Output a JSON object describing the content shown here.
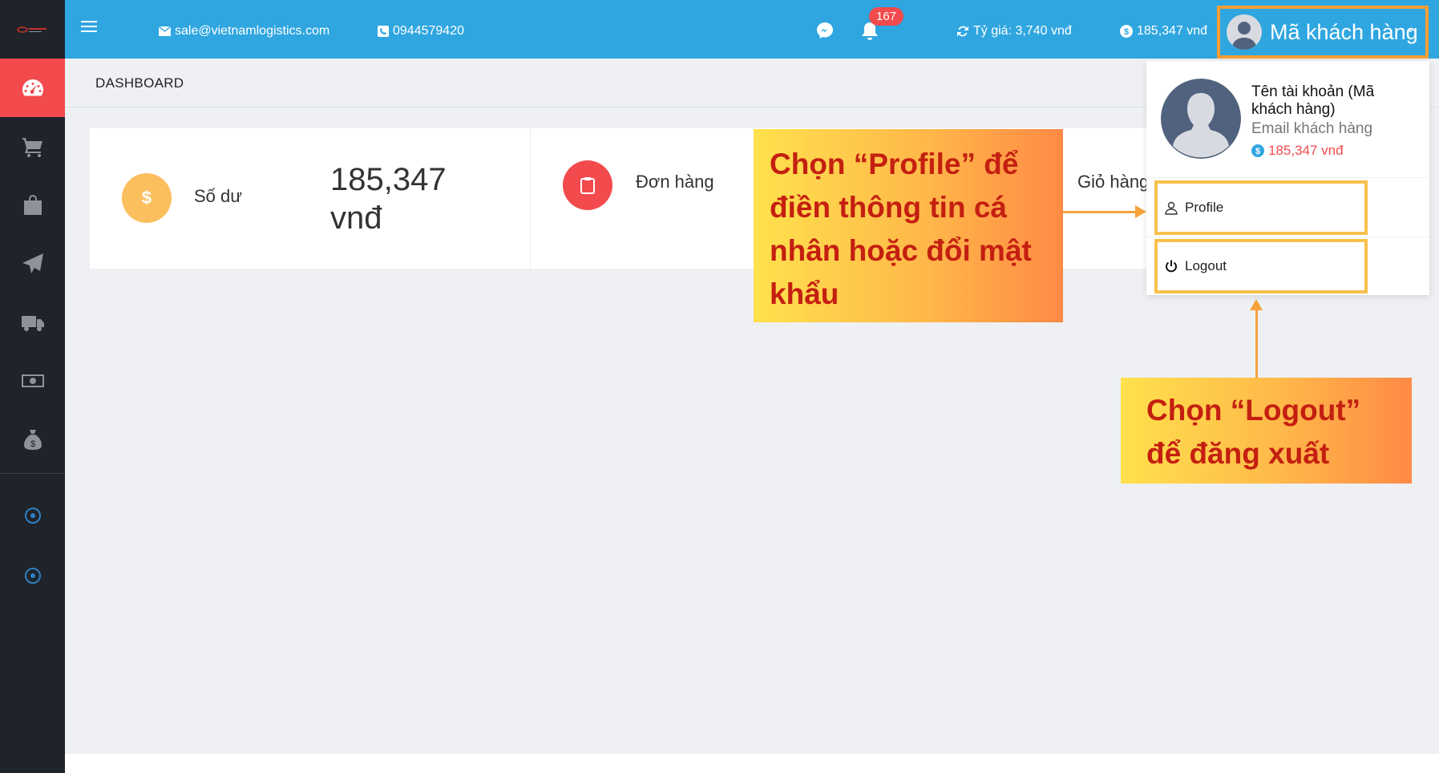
{
  "header": {
    "email": "sale@vietnamlogistics.com",
    "phone": "0944579420",
    "notification_count": "167",
    "exchange_rate": "Tỷ giá: 3,740 vnđ",
    "balance": "185,347 vnđ",
    "user_label": "Mã khách hàng"
  },
  "page": {
    "title": "DASHBOARD"
  },
  "stats": [
    {
      "label": "Số dư",
      "value": "185,347 vnđ",
      "icon": "dollar-icon"
    },
    {
      "label": "Đơn hàng",
      "value": "",
      "icon": "clipboard-icon"
    },
    {
      "label": "Giỏ hàng",
      "value": "",
      "icon": "cart-icon"
    }
  ],
  "dropdown": {
    "account_name": "Tên tài khoản (Mã khách hàng)",
    "email": "Email khách hàng",
    "balance": "185,347 vnđ",
    "profile_label": "Profile",
    "logout_label": "Logout"
  },
  "annotations": {
    "profile_hint": "Chọn “Profile” để điền thông tin cá nhân hoặc đổi mật khẩu",
    "logout_hint": "Chọn “Logout” để đăng xuất"
  },
  "colors": {
    "header": "#2fa6e0",
    "sidebar": "#1f232a",
    "active": "#f24a4d",
    "highlight": "#f59e35",
    "callout_text": "#c41f10"
  },
  "sidebar": {
    "items": [
      "dashboard-icon",
      "cart-icon",
      "shopping-bag-icon",
      "paper-plane-icon",
      "delivery-truck-icon",
      "money-icon",
      "money-bag-icon",
      "circle-dot-icon",
      "circle-dot-icon"
    ]
  }
}
